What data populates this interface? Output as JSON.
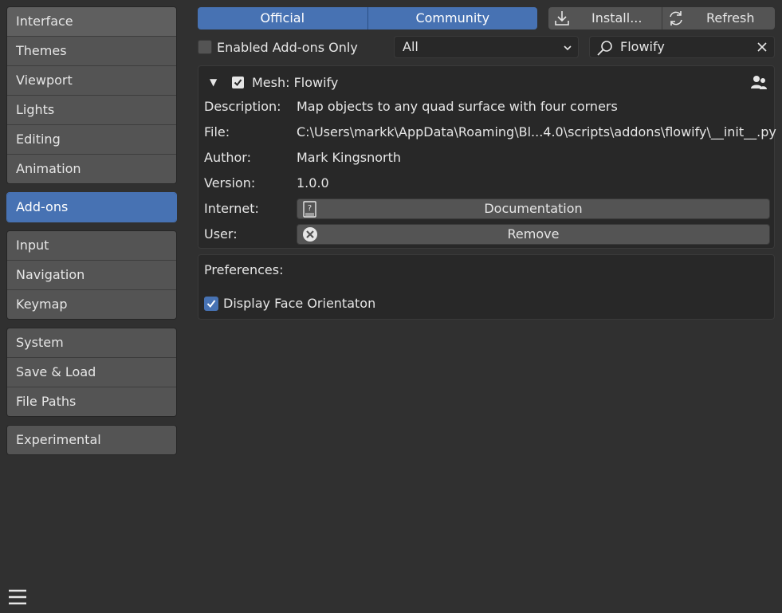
{
  "sidebar": {
    "groups": [
      [
        "Interface",
        "Themes",
        "Viewport",
        "Lights",
        "Editing",
        "Animation"
      ],
      [
        "Add-ons"
      ],
      [
        "Input",
        "Navigation",
        "Keymap"
      ],
      [
        "System",
        "Save & Load",
        "File Paths"
      ],
      [
        "Experimental"
      ]
    ],
    "active": "Add-ons"
  },
  "header": {
    "official_label": "Official",
    "community_label": "Community",
    "install_label": "Install...",
    "refresh_label": "Refresh"
  },
  "filters": {
    "enabled_only_label": "Enabled Add-ons Only",
    "enabled_only_checked": false,
    "category_value": "All",
    "search_value": "Flowify"
  },
  "addon": {
    "title": "Mesh: Flowify",
    "enabled": true,
    "description_label": "Description:",
    "description": "Map objects to any quad surface with four corners",
    "file_label": "File:",
    "file": "C:\\Users\\markk\\AppData\\Roaming\\Bl...4.0\\scripts\\addons\\flowify\\__init__.py",
    "author_label": "Author:",
    "author": "Mark Kingsnorth",
    "version_label": "Version:",
    "version": "1.0.0",
    "internet_label": "Internet:",
    "documentation_label": "Documentation",
    "user_label": "User:",
    "remove_label": "Remove"
  },
  "preferences": {
    "title": "Preferences:",
    "display_face_orientation_label": "Display Face Orientaton",
    "display_face_orientation_checked": true
  },
  "colors": {
    "accent": "#4772b3",
    "background": "#303030",
    "button": "#545454",
    "panel": "#282828"
  }
}
